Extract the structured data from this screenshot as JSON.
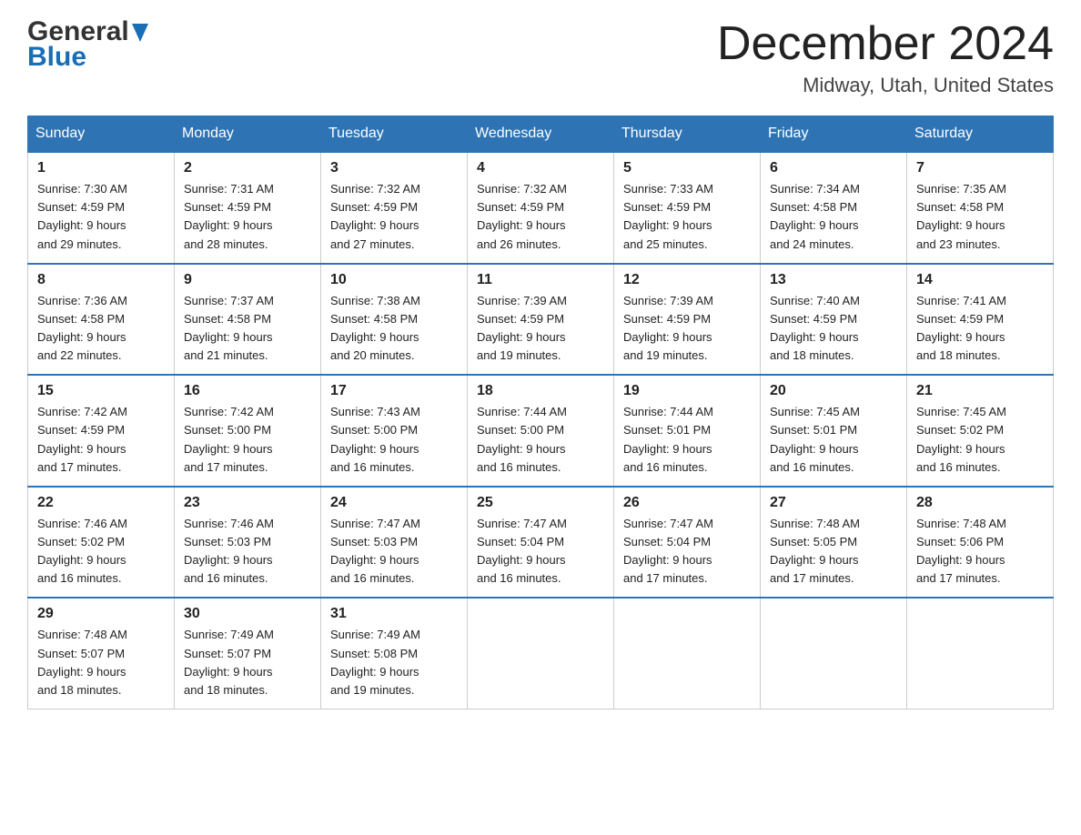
{
  "header": {
    "logo_top": "General",
    "logo_bottom": "Blue",
    "title": "December 2024",
    "subtitle": "Midway, Utah, United States"
  },
  "days_of_week": [
    "Sunday",
    "Monday",
    "Tuesday",
    "Wednesday",
    "Thursday",
    "Friday",
    "Saturday"
  ],
  "weeks": [
    [
      {
        "day": "1",
        "sunrise": "7:30 AM",
        "sunset": "4:59 PM",
        "daylight": "9 hours and 29 minutes."
      },
      {
        "day": "2",
        "sunrise": "7:31 AM",
        "sunset": "4:59 PM",
        "daylight": "9 hours and 28 minutes."
      },
      {
        "day": "3",
        "sunrise": "7:32 AM",
        "sunset": "4:59 PM",
        "daylight": "9 hours and 27 minutes."
      },
      {
        "day": "4",
        "sunrise": "7:32 AM",
        "sunset": "4:59 PM",
        "daylight": "9 hours and 26 minutes."
      },
      {
        "day": "5",
        "sunrise": "7:33 AM",
        "sunset": "4:59 PM",
        "daylight": "9 hours and 25 minutes."
      },
      {
        "day": "6",
        "sunrise": "7:34 AM",
        "sunset": "4:58 PM",
        "daylight": "9 hours and 24 minutes."
      },
      {
        "day": "7",
        "sunrise": "7:35 AM",
        "sunset": "4:58 PM",
        "daylight": "9 hours and 23 minutes."
      }
    ],
    [
      {
        "day": "8",
        "sunrise": "7:36 AM",
        "sunset": "4:58 PM",
        "daylight": "9 hours and 22 minutes."
      },
      {
        "day": "9",
        "sunrise": "7:37 AM",
        "sunset": "4:58 PM",
        "daylight": "9 hours and 21 minutes."
      },
      {
        "day": "10",
        "sunrise": "7:38 AM",
        "sunset": "4:58 PM",
        "daylight": "9 hours and 20 minutes."
      },
      {
        "day": "11",
        "sunrise": "7:39 AM",
        "sunset": "4:59 PM",
        "daylight": "9 hours and 19 minutes."
      },
      {
        "day": "12",
        "sunrise": "7:39 AM",
        "sunset": "4:59 PM",
        "daylight": "9 hours and 19 minutes."
      },
      {
        "day": "13",
        "sunrise": "7:40 AM",
        "sunset": "4:59 PM",
        "daylight": "9 hours and 18 minutes."
      },
      {
        "day": "14",
        "sunrise": "7:41 AM",
        "sunset": "4:59 PM",
        "daylight": "9 hours and 18 minutes."
      }
    ],
    [
      {
        "day": "15",
        "sunrise": "7:42 AM",
        "sunset": "4:59 PM",
        "daylight": "9 hours and 17 minutes."
      },
      {
        "day": "16",
        "sunrise": "7:42 AM",
        "sunset": "5:00 PM",
        "daylight": "9 hours and 17 minutes."
      },
      {
        "day": "17",
        "sunrise": "7:43 AM",
        "sunset": "5:00 PM",
        "daylight": "9 hours and 16 minutes."
      },
      {
        "day": "18",
        "sunrise": "7:44 AM",
        "sunset": "5:00 PM",
        "daylight": "9 hours and 16 minutes."
      },
      {
        "day": "19",
        "sunrise": "7:44 AM",
        "sunset": "5:01 PM",
        "daylight": "9 hours and 16 minutes."
      },
      {
        "day": "20",
        "sunrise": "7:45 AM",
        "sunset": "5:01 PM",
        "daylight": "9 hours and 16 minutes."
      },
      {
        "day": "21",
        "sunrise": "7:45 AM",
        "sunset": "5:02 PM",
        "daylight": "9 hours and 16 minutes."
      }
    ],
    [
      {
        "day": "22",
        "sunrise": "7:46 AM",
        "sunset": "5:02 PM",
        "daylight": "9 hours and 16 minutes."
      },
      {
        "day": "23",
        "sunrise": "7:46 AM",
        "sunset": "5:03 PM",
        "daylight": "9 hours and 16 minutes."
      },
      {
        "day": "24",
        "sunrise": "7:47 AM",
        "sunset": "5:03 PM",
        "daylight": "9 hours and 16 minutes."
      },
      {
        "day": "25",
        "sunrise": "7:47 AM",
        "sunset": "5:04 PM",
        "daylight": "9 hours and 16 minutes."
      },
      {
        "day": "26",
        "sunrise": "7:47 AM",
        "sunset": "5:04 PM",
        "daylight": "9 hours and 17 minutes."
      },
      {
        "day": "27",
        "sunrise": "7:48 AM",
        "sunset": "5:05 PM",
        "daylight": "9 hours and 17 minutes."
      },
      {
        "day": "28",
        "sunrise": "7:48 AM",
        "sunset": "5:06 PM",
        "daylight": "9 hours and 17 minutes."
      }
    ],
    [
      {
        "day": "29",
        "sunrise": "7:48 AM",
        "sunset": "5:07 PM",
        "daylight": "9 hours and 18 minutes."
      },
      {
        "day": "30",
        "sunrise": "7:49 AM",
        "sunset": "5:07 PM",
        "daylight": "9 hours and 18 minutes."
      },
      {
        "day": "31",
        "sunrise": "7:49 AM",
        "sunset": "5:08 PM",
        "daylight": "9 hours and 19 minutes."
      },
      null,
      null,
      null,
      null
    ]
  ]
}
